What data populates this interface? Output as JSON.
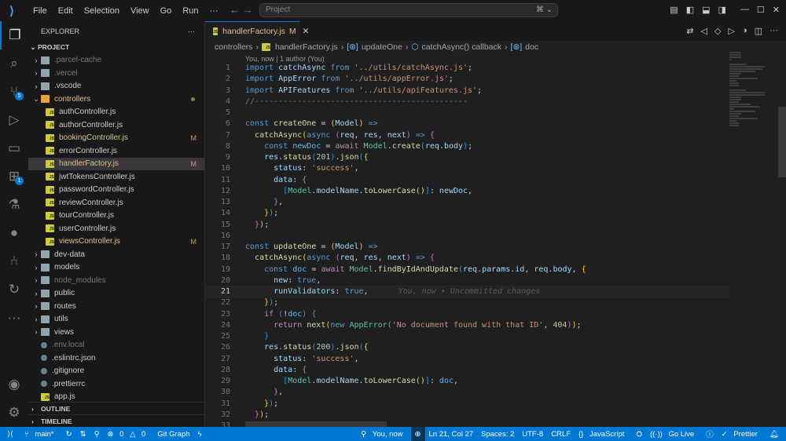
{
  "titlebar": {
    "menu": [
      "File",
      "Edit",
      "Selection",
      "View",
      "Go",
      "Run",
      "···"
    ],
    "search_placeholder": "Project"
  },
  "activity": {
    "scm_badge": "5",
    "ext_badge": "1"
  },
  "sidebar": {
    "title": "EXPLORER",
    "more": "···",
    "project": "PROJECT",
    "items": [
      {
        "label": ".parcel-cache",
        "type": "folder",
        "depth": 0,
        "dim": true
      },
      {
        "label": ".vercel",
        "type": "folder",
        "depth": 0,
        "dim": true
      },
      {
        "label": ".vscode",
        "type": "folder",
        "depth": 0
      },
      {
        "label": "controllers",
        "type": "folder",
        "depth": 0,
        "open": true,
        "modified": "dot"
      },
      {
        "label": "authController.js",
        "type": "js",
        "depth": 1
      },
      {
        "label": "authorController.js",
        "type": "js",
        "depth": 1
      },
      {
        "label": "bookingController.js",
        "type": "js",
        "depth": 1,
        "modified": "M"
      },
      {
        "label": "errorController.js",
        "type": "js",
        "depth": 1
      },
      {
        "label": "handlerFactory.js",
        "type": "js",
        "depth": 1,
        "modified": "M",
        "selected": true
      },
      {
        "label": "jwtTokensController.js",
        "type": "js",
        "depth": 1
      },
      {
        "label": "passwordController.js",
        "type": "js",
        "depth": 1
      },
      {
        "label": "reviewController.js",
        "type": "js",
        "depth": 1
      },
      {
        "label": "tourController.js",
        "type": "js",
        "depth": 1
      },
      {
        "label": "userController.js",
        "type": "js",
        "depth": 1
      },
      {
        "label": "viewsController.js",
        "type": "js",
        "depth": 1,
        "modified": "M"
      },
      {
        "label": "dev-data",
        "type": "folder",
        "depth": 0
      },
      {
        "label": "models",
        "type": "folder",
        "depth": 0
      },
      {
        "label": "node_modules",
        "type": "folder",
        "depth": 0,
        "dim": true
      },
      {
        "label": "public",
        "type": "folder",
        "depth": 0
      },
      {
        "label": "routes",
        "type": "folder",
        "depth": 0
      },
      {
        "label": "utils",
        "type": "folder",
        "depth": 0
      },
      {
        "label": "views",
        "type": "folder",
        "depth": 0
      },
      {
        "label": ".env.local",
        "type": "file",
        "depth": 0,
        "dim": true
      },
      {
        "label": ".eslintrc.json",
        "type": "file",
        "depth": 0
      },
      {
        "label": ".gitignore",
        "type": "file",
        "depth": 0
      },
      {
        "label": ".prettierrc",
        "type": "file",
        "depth": 0
      },
      {
        "label": "app.js",
        "type": "js",
        "depth": 0
      }
    ],
    "outline": "OUTLINE",
    "timeline": "TIMELINE"
  },
  "editor": {
    "tab": {
      "label": "handlerFactory.js",
      "status": "M"
    },
    "breadcrumbs": [
      "controllers",
      "handlerFactory.js",
      "updateOne",
      "catchAsync() callback",
      "doc"
    ],
    "codelens": "You, now | 1 author (You)",
    "current_line": 21,
    "blame": "You, now • Uncommitted changes",
    "lines": [
      [
        [
          "k",
          "import"
        ],
        [
          "v",
          " catchAsync "
        ],
        [
          "k",
          "from"
        ],
        [
          "s",
          " '../utils/catchAsync.js'"
        ],
        [
          "p",
          ";"
        ]
      ],
      [
        [
          "k",
          "import"
        ],
        [
          "v",
          " AppError "
        ],
        [
          "k",
          "from"
        ],
        [
          "s",
          " '../utils/appError.js'"
        ],
        [
          "p",
          ";"
        ]
      ],
      [
        [
          "k",
          "import"
        ],
        [
          "v",
          " APIFeatures "
        ],
        [
          "k",
          "from"
        ],
        [
          "s",
          " '../utils/apiFeatures.js'"
        ],
        [
          "p",
          ";"
        ]
      ],
      [
        [
          "cm",
          "//---------------------------------------------"
        ]
      ],
      [],
      [
        [
          "k",
          "const"
        ],
        [
          "f",
          " createOne"
        ],
        [
          "p",
          " = "
        ],
        [
          "b1",
          "("
        ],
        [
          "v",
          "Model"
        ],
        [
          "b1",
          ")"
        ],
        [
          "k",
          " =>"
        ]
      ],
      [
        [
          "p",
          "  "
        ],
        [
          "f",
          "catchAsync"
        ],
        [
          "b1",
          "("
        ],
        [
          "k",
          "async"
        ],
        [
          "p",
          " "
        ],
        [
          "b2",
          "("
        ],
        [
          "v",
          "req"
        ],
        [
          "p",
          ", "
        ],
        [
          "v",
          "res"
        ],
        [
          "p",
          ", "
        ],
        [
          "v",
          "next"
        ],
        [
          "b2",
          ")"
        ],
        [
          "k",
          " =>"
        ],
        [
          "p",
          " "
        ],
        [
          "b2",
          "{"
        ]
      ],
      [
        [
          "p",
          "    "
        ],
        [
          "k",
          "const"
        ],
        [
          "cst",
          " newDoc"
        ],
        [
          "p",
          " = "
        ],
        [
          "c",
          "await"
        ],
        [
          "t",
          " Model"
        ],
        [
          "p",
          "."
        ],
        [
          "f",
          "create"
        ],
        [
          "b3",
          "("
        ],
        [
          "v",
          "req"
        ],
        [
          "p",
          "."
        ],
        [
          "v",
          "body"
        ],
        [
          "b3",
          ")"
        ],
        [
          "p",
          ";"
        ]
      ],
      [
        [
          "p",
          "    "
        ],
        [
          "v",
          "res"
        ],
        [
          "p",
          "."
        ],
        [
          "f",
          "status"
        ],
        [
          "b3",
          "("
        ],
        [
          "n",
          "201"
        ],
        [
          "b3",
          ")"
        ],
        [
          "p",
          "."
        ],
        [
          "f",
          "json"
        ],
        [
          "b3",
          "("
        ],
        [
          "b1",
          "{"
        ]
      ],
      [
        [
          "p",
          "      "
        ],
        [
          "v",
          "status"
        ],
        [
          "p",
          ": "
        ],
        [
          "s",
          "'success'"
        ],
        [
          "p",
          ","
        ]
      ],
      [
        [
          "p",
          "      "
        ],
        [
          "v",
          "data"
        ],
        [
          "p",
          ": "
        ],
        [
          "b2",
          "{"
        ]
      ],
      [
        [
          "p",
          "        "
        ],
        [
          "b3",
          "["
        ],
        [
          "t",
          "Model"
        ],
        [
          "p",
          "."
        ],
        [
          "v",
          "modelName"
        ],
        [
          "p",
          "."
        ],
        [
          "f",
          "toLowerCase"
        ],
        [
          "b1",
          "()"
        ],
        [
          "b3",
          "]"
        ],
        [
          "p",
          ": "
        ],
        [
          "v",
          "newDoc"
        ],
        [
          "p",
          ","
        ]
      ],
      [
        [
          "p",
          "      "
        ],
        [
          "b2",
          "}"
        ],
        [
          "p",
          ","
        ]
      ],
      [
        [
          "p",
          "    "
        ],
        [
          "b1",
          "}"
        ],
        [
          "b3",
          ")"
        ],
        [
          "p",
          ";"
        ]
      ],
      [
        [
          "p",
          "  "
        ],
        [
          "b2",
          "}"
        ],
        [
          "b1",
          ")"
        ],
        [
          "p",
          ";"
        ]
      ],
      [],
      [
        [
          "k",
          "const"
        ],
        [
          "f",
          " updateOne"
        ],
        [
          "p",
          " = "
        ],
        [
          "b1",
          "("
        ],
        [
          "v",
          "Model"
        ],
        [
          "b1",
          ")"
        ],
        [
          "k",
          " =>"
        ]
      ],
      [
        [
          "p",
          "  "
        ],
        [
          "f",
          "catchAsync"
        ],
        [
          "b1",
          "("
        ],
        [
          "k",
          "async"
        ],
        [
          "p",
          " "
        ],
        [
          "b2",
          "("
        ],
        [
          "v",
          "req"
        ],
        [
          "p",
          ", "
        ],
        [
          "v",
          "res"
        ],
        [
          "p",
          ", "
        ],
        [
          "v",
          "next"
        ],
        [
          "b2",
          ")"
        ],
        [
          "k",
          " =>"
        ],
        [
          "p",
          " "
        ],
        [
          "b2",
          "{"
        ]
      ],
      [
        [
          "p",
          "    "
        ],
        [
          "k",
          "const"
        ],
        [
          "cst",
          " doc"
        ],
        [
          "p",
          " = "
        ],
        [
          "c",
          "await"
        ],
        [
          "t",
          " Model"
        ],
        [
          "p",
          "."
        ],
        [
          "f",
          "findByIdAndUpdate"
        ],
        [
          "b3",
          "("
        ],
        [
          "v",
          "req"
        ],
        [
          "p",
          "."
        ],
        [
          "v",
          "params"
        ],
        [
          "p",
          "."
        ],
        [
          "v",
          "id"
        ],
        [
          "p",
          ", "
        ],
        [
          "v",
          "req"
        ],
        [
          "p",
          "."
        ],
        [
          "v",
          "body"
        ],
        [
          "p",
          ", "
        ],
        [
          "b1",
          "{"
        ]
      ],
      [
        [
          "p",
          "      "
        ],
        [
          "v",
          "new"
        ],
        [
          "p",
          ": "
        ],
        [
          "k",
          "true"
        ],
        [
          "p",
          ","
        ]
      ],
      [
        [
          "p",
          "      "
        ],
        [
          "v",
          "runValidators"
        ],
        [
          "p",
          ": "
        ],
        [
          "k",
          "true"
        ],
        [
          "p",
          ","
        ]
      ],
      [
        [
          "p",
          "    "
        ],
        [
          "b1",
          "}"
        ],
        [
          "b3",
          ")"
        ],
        [
          "p",
          ";"
        ]
      ],
      [
        [
          "p",
          "    "
        ],
        [
          "c",
          "if"
        ],
        [
          "p",
          " "
        ],
        [
          "b3",
          "("
        ],
        [
          "p",
          "!"
        ],
        [
          "cst",
          "doc"
        ],
        [
          "b3",
          ")"
        ],
        [
          "p",
          " "
        ],
        [
          "b3",
          "{"
        ]
      ],
      [
        [
          "p",
          "      "
        ],
        [
          "c",
          "return"
        ],
        [
          "f",
          " next"
        ],
        [
          "b1",
          "("
        ],
        [
          "k",
          "new"
        ],
        [
          "t",
          " AppError"
        ],
        [
          "b2",
          "("
        ],
        [
          "s",
          "'No document found with that ID'"
        ],
        [
          "p",
          ", "
        ],
        [
          "n",
          "404"
        ],
        [
          "b2",
          ")"
        ],
        [
          "b1",
          ")"
        ],
        [
          "p",
          ";"
        ]
      ],
      [
        [
          "p",
          "    "
        ],
        [
          "b3",
          "}"
        ]
      ],
      [
        [
          "p",
          "    "
        ],
        [
          "v",
          "res"
        ],
        [
          "p",
          "."
        ],
        [
          "f",
          "status"
        ],
        [
          "b3",
          "("
        ],
        [
          "n",
          "200"
        ],
        [
          "b3",
          ")"
        ],
        [
          "p",
          "."
        ],
        [
          "f",
          "json"
        ],
        [
          "b3",
          "("
        ],
        [
          "b1",
          "{"
        ]
      ],
      [
        [
          "p",
          "      "
        ],
        [
          "v",
          "status"
        ],
        [
          "p",
          ": "
        ],
        [
          "s",
          "'success'"
        ],
        [
          "p",
          ","
        ]
      ],
      [
        [
          "p",
          "      "
        ],
        [
          "v",
          "data"
        ],
        [
          "p",
          ": "
        ],
        [
          "b2",
          "{"
        ]
      ],
      [
        [
          "p",
          "        "
        ],
        [
          "b3",
          "["
        ],
        [
          "t",
          "Model"
        ],
        [
          "p",
          "."
        ],
        [
          "v",
          "modelName"
        ],
        [
          "p",
          "."
        ],
        [
          "f",
          "toLowerCase"
        ],
        [
          "b1",
          "()"
        ],
        [
          "b3",
          "]"
        ],
        [
          "p",
          ": "
        ],
        [
          "cst",
          "doc"
        ],
        [
          "p",
          ","
        ]
      ],
      [
        [
          "p",
          "      "
        ],
        [
          "b2",
          "}"
        ],
        [
          "p",
          ","
        ]
      ],
      [
        [
          "p",
          "    "
        ],
        [
          "b1",
          "}"
        ],
        [
          "b3",
          ")"
        ],
        [
          "p",
          ";"
        ]
      ],
      [
        [
          "p",
          "  "
        ],
        [
          "b2",
          "}"
        ],
        [
          "b1",
          ")"
        ],
        [
          "p",
          ";"
        ]
      ],
      []
    ]
  },
  "statusbar": {
    "branch": "main*",
    "problems_errors": "0",
    "problems_warnings": "0",
    "git_graph": "Git Graph",
    "blame": "You, now",
    "position": "Ln 21, Col 27",
    "spaces": "Spaces: 2",
    "encoding": "UTF-8",
    "eol": "CRLF",
    "language": "JavaScript",
    "golive": "Go Live",
    "prettier": "Prettier"
  }
}
